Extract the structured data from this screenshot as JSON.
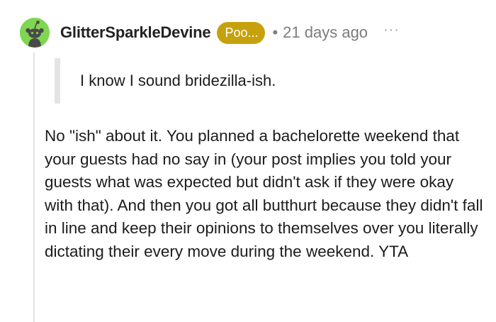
{
  "comment": {
    "author": {
      "username": "GlitterSparkleDevine",
      "flair": "Poo...",
      "avatar_icon": "snoo-avatar-icon",
      "avatar_color": "#7fd651"
    },
    "separator": "•",
    "timestamp": "21 days ago",
    "more_options": "···",
    "quote": "I know I sound bridezilla-ish.",
    "body": "No \"ish\" about it. You planned a bachelorette weekend that your guests had no say in (your post implies you told your guests what was expected but didn't ask if they were okay with that). And then you got all butthurt because they didn't fall in line and keep their opinions to themselves over you literally dictating their every move during the weekend. YTA"
  },
  "colors": {
    "flair_background": "#c7a10c",
    "thread_line": "#e3e3e3",
    "quote_bar": "#e4e4e4",
    "meta_text": "#7c7c7c"
  }
}
